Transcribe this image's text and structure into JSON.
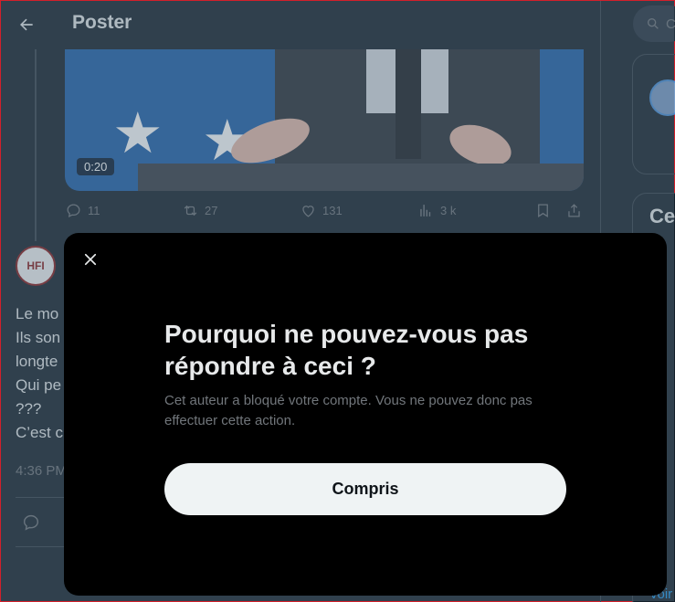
{
  "header": {
    "title": "Poster"
  },
  "video": {
    "duration": "0:20"
  },
  "actions": {
    "replies": "11",
    "reposts": "27",
    "likes": "131",
    "views": "3 k"
  },
  "tweet": {
    "text_lines": [
      "Le mo",
      "Ils son",
      "longte",
      "Qui pe",
      "???",
      "C’est c"
    ],
    "time": "4:36 PM"
  },
  "sidebar": {
    "search_placeholder": "C",
    "trends_title": "Ce",
    "more_link": "voir"
  },
  "modal": {
    "title": "Pourquoi ne pouvez-vous pas répondre à ceci ?",
    "description": "Cet auteur a bloqué votre compte. Vous ne pouvez donc pas effectuer cette action.",
    "button_label": "Compris"
  },
  "colors": {
    "background": "#15202b",
    "modal": "#000000",
    "button": "#eff3f4",
    "muted": "#71767b",
    "accent": "#1d9bf0"
  }
}
